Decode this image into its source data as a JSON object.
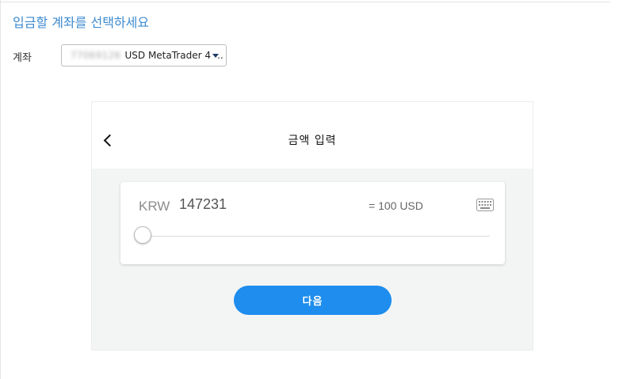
{
  "page": {
    "title": "입금할 계좌를 선택하세요"
  },
  "account": {
    "label": "계좌",
    "selected_number": "77069126",
    "selected_desc": "USD MetaTrader 4 -.."
  },
  "amount_widget": {
    "title": "금액 입력",
    "currency": "KRW",
    "amount_value": "147231",
    "converted_text": "= 100 USD",
    "slider_fraction": 0.0,
    "next_label": "다음"
  },
  "colors": {
    "accent": "#1e8ded",
    "title_blue": "#3d8bd0",
    "panel_bg": "#f3f5f5"
  },
  "icons": {
    "back": "chevron-left-icon",
    "keyboard": "keyboard-icon",
    "dropdown": "caret-down-icon"
  }
}
